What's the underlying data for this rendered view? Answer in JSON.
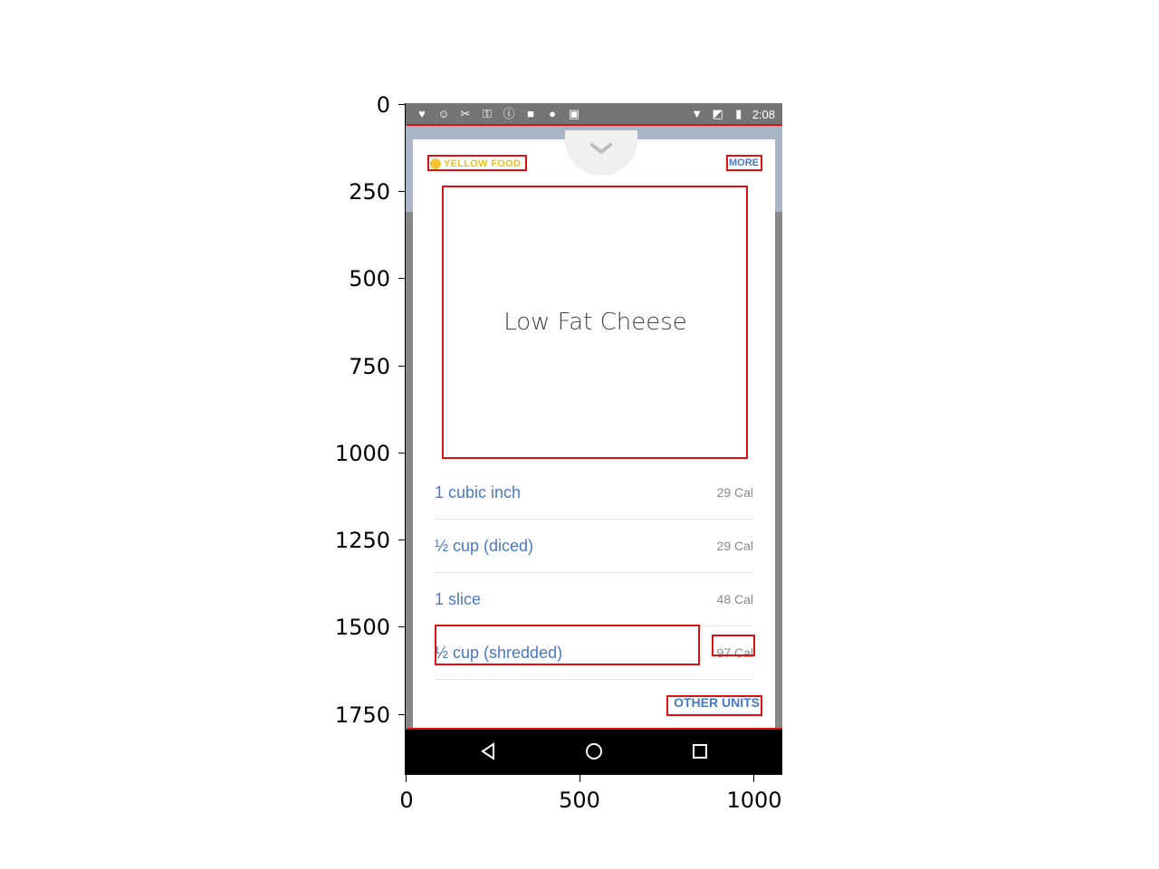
{
  "axes": {
    "y_ticks": [
      "0",
      "250",
      "500",
      "750",
      "1000",
      "1250",
      "1500",
      "1750"
    ],
    "x_ticks": [
      "0",
      "500",
      "1000"
    ]
  },
  "status_bar": {
    "time": "2:08",
    "left_icons": [
      "heart-icon",
      "app-icon",
      "tools-icon",
      "key-icon",
      "info-icon",
      "lock-icon",
      "cat-icon",
      "bag-icon"
    ],
    "right_icons": [
      "wifi-icon",
      "no-signal-icon",
      "battery-icon"
    ]
  },
  "card": {
    "food_tag": "YELLOW FOOD",
    "more_label": "MORE",
    "food_name": "Low Fat Cheese",
    "units": [
      {
        "label": "1 cubic inch",
        "cal": "29 Cal"
      },
      {
        "label": "½ cup (diced)",
        "cal": "29 Cal"
      },
      {
        "label": "1 slice",
        "cal": "48 Cal"
      },
      {
        "label": "½ cup (shredded)",
        "cal": "97 Cal"
      }
    ],
    "other_units_label": "OTHER UNITS"
  },
  "colors": {
    "accent": "#4a78c2",
    "tag": "#e8c01a",
    "annotation": "#e01010"
  }
}
